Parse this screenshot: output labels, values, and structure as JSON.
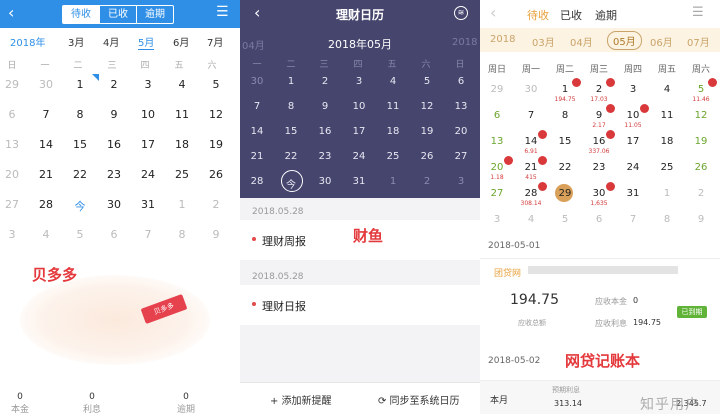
{
  "panel1": {
    "segment": [
      "待收",
      "已收",
      "逾期"
    ],
    "months": [
      "2018年",
      "3月",
      "4月",
      "5月",
      "6月",
      "7月"
    ],
    "weekdays": [
      "日",
      "一",
      "二",
      "三",
      "四",
      "五",
      "六"
    ],
    "rows": [
      [
        "29",
        "30",
        "1",
        "2",
        "3",
        "4",
        "5"
      ],
      [
        "6",
        "7",
        "8",
        "9",
        "10",
        "11",
        "12"
      ],
      [
        "13",
        "14",
        "15",
        "16",
        "17",
        "18",
        "19"
      ],
      [
        "20",
        "21",
        "22",
        "23",
        "24",
        "25",
        "26"
      ],
      [
        "27",
        "28",
        "今",
        "30",
        "31",
        "1",
        "2"
      ],
      [
        "3",
        "4",
        "5",
        "6",
        "7",
        "8",
        "9"
      ]
    ],
    "watermark": "贝多多",
    "stamp_text": "贝多多",
    "stats": [
      {
        "value": "0",
        "label": "本金"
      },
      {
        "value": "0",
        "label": "利息"
      },
      {
        "value": "0",
        "label": "逾期"
      }
    ]
  },
  "panel2": {
    "title": "理财日历",
    "month": "2018年05月",
    "side_left": "04月",
    "side_right": "2018",
    "weekdays": [
      "一",
      "二",
      "三",
      "四",
      "五",
      "六",
      "日"
    ],
    "rows": [
      [
        "30",
        "1",
        "2",
        "3",
        "4",
        "5",
        "6"
      ],
      [
        "7",
        "8",
        "9",
        "10",
        "11",
        "12",
        "13"
      ],
      [
        "14",
        "15",
        "16",
        "17",
        "18",
        "19",
        "20"
      ],
      [
        "21",
        "22",
        "23",
        "24",
        "25",
        "26",
        "27"
      ],
      [
        "28",
        "今",
        "30",
        "31",
        "1",
        "2",
        "3"
      ]
    ],
    "entries": [
      {
        "date": "2018.05.28",
        "label": "理财周报"
      },
      {
        "date": "2018.05.28",
        "label": "理财日报"
      }
    ],
    "watermark": "财鱼",
    "footer_add": "+ 添加新提醒",
    "footer_sync": "⟳ 同步至系统日历"
  },
  "panel3": {
    "tabs": [
      "待收",
      "已收",
      "逾期"
    ],
    "months": [
      "2018",
      "03月",
      "04月",
      "05月",
      "06月",
      "07月"
    ],
    "weekdays": [
      "周日",
      "周一",
      "周二",
      "周三",
      "周四",
      "周五",
      "周六"
    ],
    "rows": [
      [
        "29",
        "30",
        "1",
        "2",
        "3",
        "4",
        "5"
      ],
      [
        "6",
        "7",
        "8",
        "9",
        "10",
        "11",
        "12"
      ],
      [
        "13",
        "14",
        "15",
        "16",
        "17",
        "18",
        "19"
      ],
      [
        "20",
        "21",
        "22",
        "23",
        "24",
        "25",
        "26"
      ],
      [
        "27",
        "28",
        "29",
        "30",
        "31",
        "1",
        "2"
      ],
      [
        "3",
        "4",
        "5",
        "6",
        "7",
        "8",
        "9"
      ]
    ],
    "sub_values": [
      {
        "text": "194.75",
        "row": 0,
        "col": 2
      },
      {
        "text": "17.03",
        "row": 0,
        "col": 3
      },
      {
        "text": "11.46",
        "row": 0,
        "col": 6
      },
      {
        "text": "2.17",
        "row": 1,
        "col": 3
      },
      {
        "text": "11.05",
        "row": 1,
        "col": 4
      },
      {
        "text": "6.91",
        "row": 2,
        "col": 1
      },
      {
        "text": "337.06",
        "row": 2,
        "col": 3
      },
      {
        "text": "1.18",
        "row": 3,
        "col": 0
      },
      {
        "text": "415",
        "row": 3,
        "col": 1
      },
      {
        "text": "308.14",
        "row": 4,
        "col": 1
      },
      {
        "text": "1,635",
        "row": 4,
        "col": 3
      }
    ],
    "section_date": "2018-05-01",
    "platform": "团贷网",
    "amount": "194.75",
    "amount_label": "应收总额",
    "principal_label": "应收本金",
    "principal_value": "0",
    "interest_label": "应收利息",
    "interest_value": "194.75",
    "status": "已到期",
    "next_date": "2018-05-02",
    "footer_left": "本月",
    "footer_mid_label": "预期利息",
    "footer_mid_value": "313.14",
    "footer_right_value": "2,345.7",
    "watermark": "网贷记账本",
    "corner_mark": "知乎用户"
  },
  "colors": {
    "blue": "#2f8fe6",
    "navy": "#45456e",
    "gold": "#e8a03a",
    "red": "#e4393c",
    "green": "#5fb336"
  }
}
